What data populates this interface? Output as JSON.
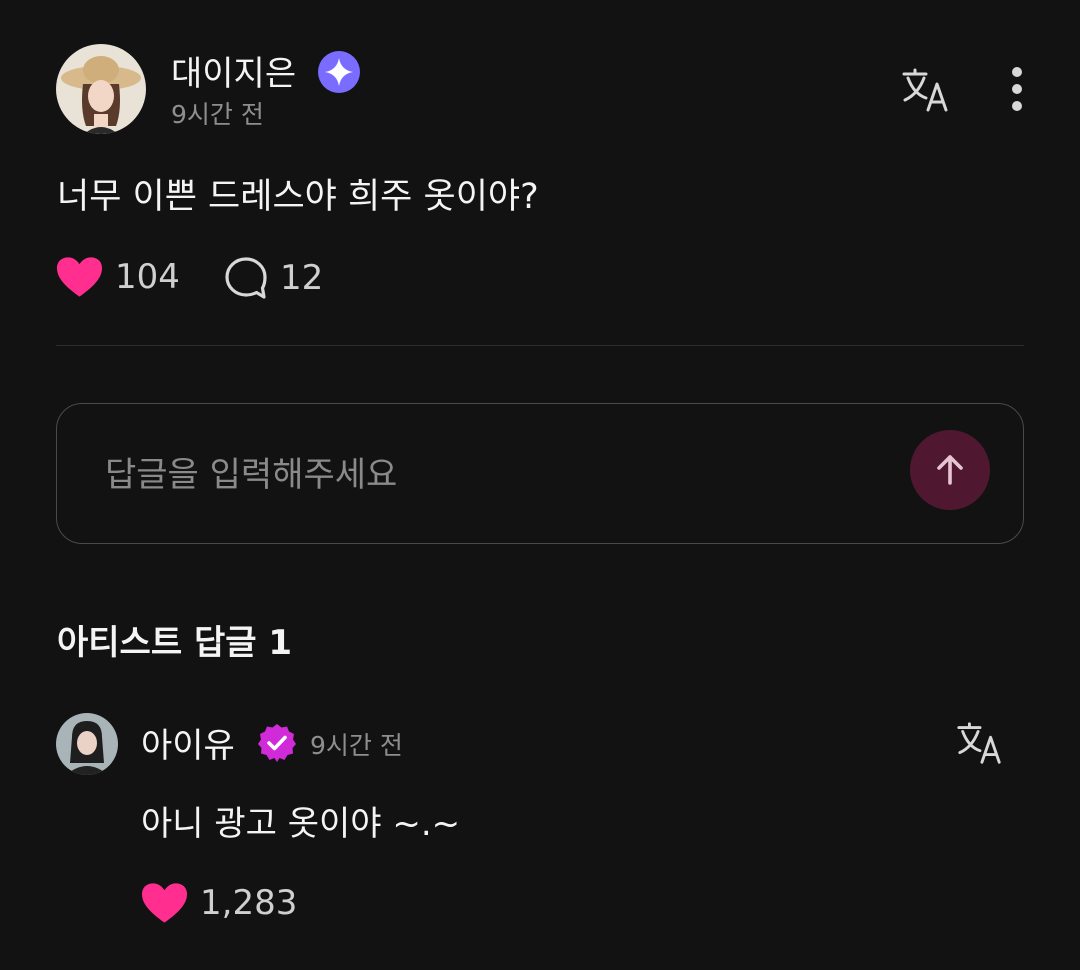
{
  "post": {
    "author": "대이지은",
    "verified_badge": "sparkle-badge-icon",
    "timestamp": "9시간 전",
    "text": "너무 이쁜 드레스야 희주 옷이야?",
    "likes": "104",
    "comments": "12",
    "translate_icon": "translate-icon",
    "more_icon": "more-vertical-icon"
  },
  "reply_input": {
    "placeholder": "답글을 입력해주세요",
    "send_icon": "arrow-up-icon"
  },
  "artist_replies": {
    "title": "아티스트 답글 1",
    "items": [
      {
        "author": "아이유",
        "verified_badge": "verified-check-badge-icon",
        "timestamp": "9시간 전",
        "text": "아니 광고 옷이야 ~.~",
        "likes": "1,283"
      }
    ]
  },
  "colors": {
    "background": "#121212",
    "heart": "#ff2e8f",
    "post_badge": "#7a6cff",
    "artist_badge": "#d12ad8",
    "send_button": "#4f1830",
    "muted_text": "#8e8e8e"
  }
}
